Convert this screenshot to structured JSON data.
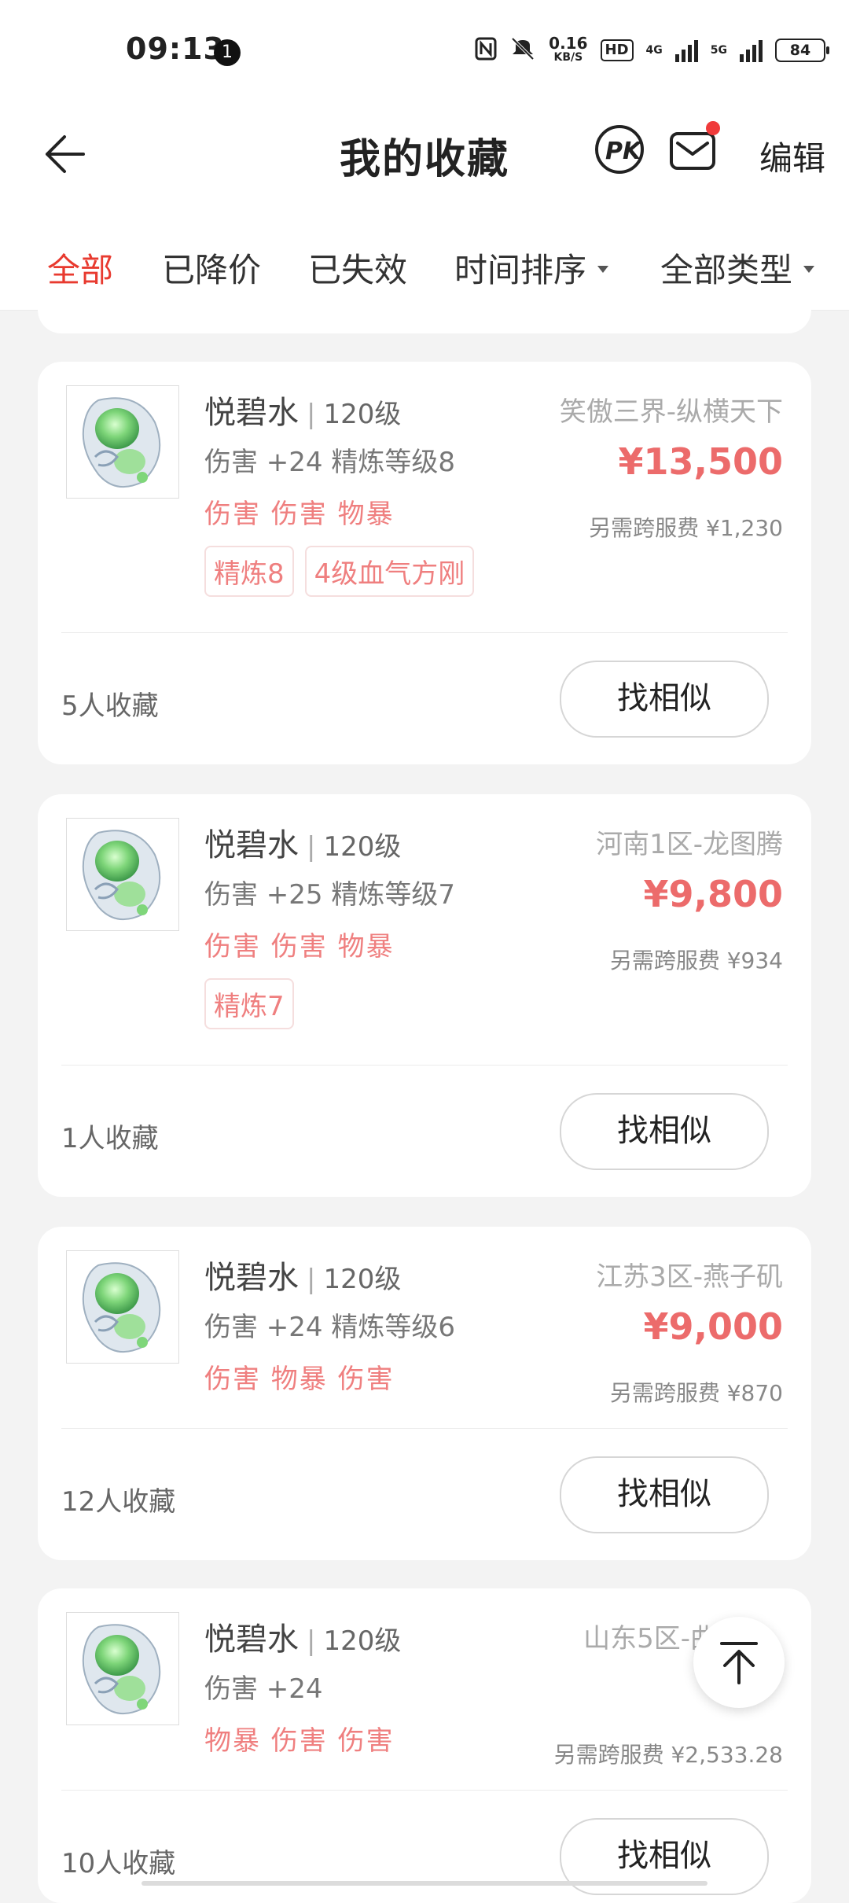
{
  "status_bar": {
    "time": "09:13",
    "badge": "1",
    "net_speed": "0.16",
    "net_unit": "KB/S",
    "hd": "HD",
    "net1": "4G",
    "net2": "5G",
    "battery": "84"
  },
  "header": {
    "title": "我的收藏",
    "edit_label": "编辑"
  },
  "tabs": [
    {
      "label": "全部",
      "active": true
    },
    {
      "label": "已降价"
    },
    {
      "label": "已失效"
    },
    {
      "label": "时间排序"
    },
    {
      "label": "全部类型"
    }
  ],
  "items": [
    {
      "name": "悦碧水",
      "level": "120级",
      "server": "笑傲三界-纵横天下",
      "attr": "伤害 +24 精炼等级8",
      "effects": "伤害 伤害 物暴",
      "tags": [
        "精炼8",
        "4级血气方刚"
      ],
      "price": "¥13,500",
      "fee": "另需跨服费 ¥1,230",
      "fav_count": "5人收藏",
      "similar_label": "找相似"
    },
    {
      "name": "悦碧水",
      "level": "120级",
      "server": "河南1区-龙图腾",
      "attr": "伤害 +25 精炼等级7",
      "effects": "伤害 伤害 物暴",
      "tags": [
        "精炼7"
      ],
      "price": "¥9,800",
      "fee": "另需跨服费 ¥934",
      "fav_count": "1人收藏",
      "similar_label": "找相似"
    },
    {
      "name": "悦碧水",
      "level": "120级",
      "server": "江苏3区-燕子矶",
      "attr": "伤害 +24 精炼等级6",
      "effects": "伤害 物暴 伤害",
      "tags": [],
      "price": "¥9,000",
      "fee": "另需跨服费 ¥870",
      "fav_count": "12人收藏",
      "similar_label": "找相似"
    },
    {
      "name": "悦碧水",
      "level": "120级",
      "server": "山东5区-曲",
      "attr": "伤害 +24",
      "effects": "物暴 伤害 伤害",
      "tags": [],
      "price": "",
      "fee": "另需跨服费 ¥2,533.28",
      "fav_count": "10人收藏",
      "similar_label": "找相似"
    }
  ],
  "icons": {
    "back": "arrow-left-icon",
    "pk": "pk-icon",
    "mail": "mail-icon",
    "to_top": "arrow-up-to-top-icon"
  },
  "colors": {
    "accent": "#e83a2f",
    "price": "#ec6b6b",
    "effect": "#ef7f7f"
  }
}
